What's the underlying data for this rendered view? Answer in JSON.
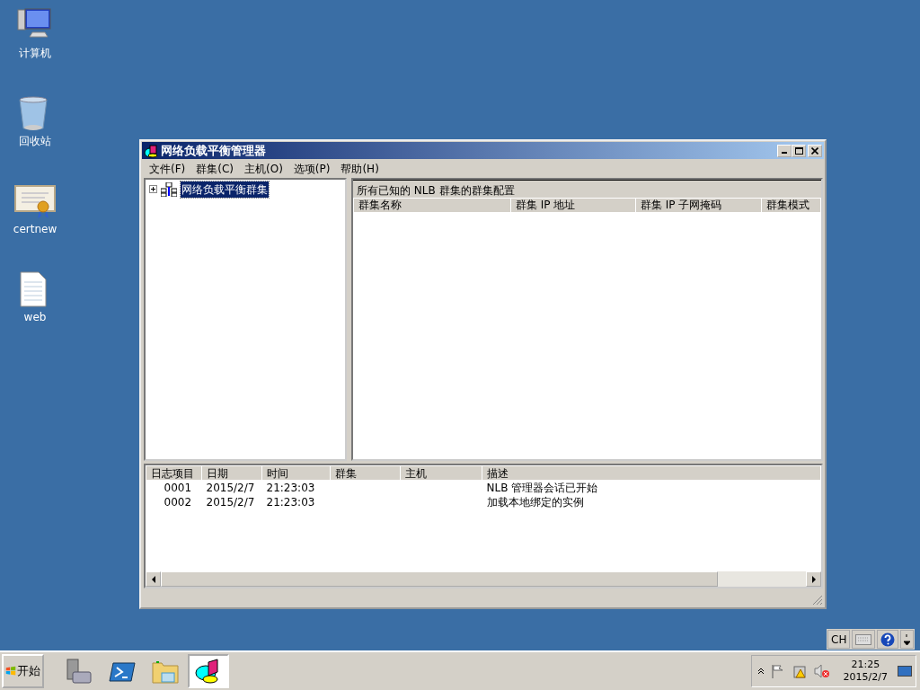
{
  "desktop_icons": [
    {
      "kind": "computer",
      "label": "计算机"
    },
    {
      "kind": "recycle",
      "label": "回收站"
    },
    {
      "kind": "certificate",
      "label": "certnew"
    },
    {
      "kind": "document",
      "label": "web"
    }
  ],
  "window": {
    "title": "网络负载平衡管理器",
    "menu": [
      "文件(F)",
      "群集(C)",
      "主机(O)",
      "选项(P)",
      "帮助(H)"
    ],
    "tree": [
      {
        "label": "网络负载平衡群集",
        "expanded": false,
        "selected": true
      }
    ],
    "cluster_panel": {
      "heading": "所有已知的 NLB 群集的群集配置",
      "columns": [
        "群集名称",
        "群集 IP 地址",
        "群集 IP 子网掩码",
        "群集模式"
      ]
    },
    "log": {
      "columns": [
        "日志项目",
        "日期",
        "时间",
        "群集",
        "主机",
        "描述"
      ],
      "rows": [
        [
          "0001",
          "2015/2/7",
          "21:23:03",
          "",
          "",
          "NLB 管理器会话已开始"
        ],
        [
          "0002",
          "2015/2/7",
          "21:23:03",
          "",
          "",
          "加载本地绑定的实例"
        ]
      ]
    }
  },
  "language_bar": {
    "label": "CH"
  },
  "taskbar": {
    "start": "开始",
    "apps": [
      {
        "kind": "server",
        "selected": false
      },
      {
        "kind": "shell",
        "selected": false
      },
      {
        "kind": "folder",
        "selected": false
      },
      {
        "kind": "chart",
        "selected": true
      }
    ],
    "clock": {
      "time": "21:25",
      "date": "2015/2/7"
    }
  }
}
